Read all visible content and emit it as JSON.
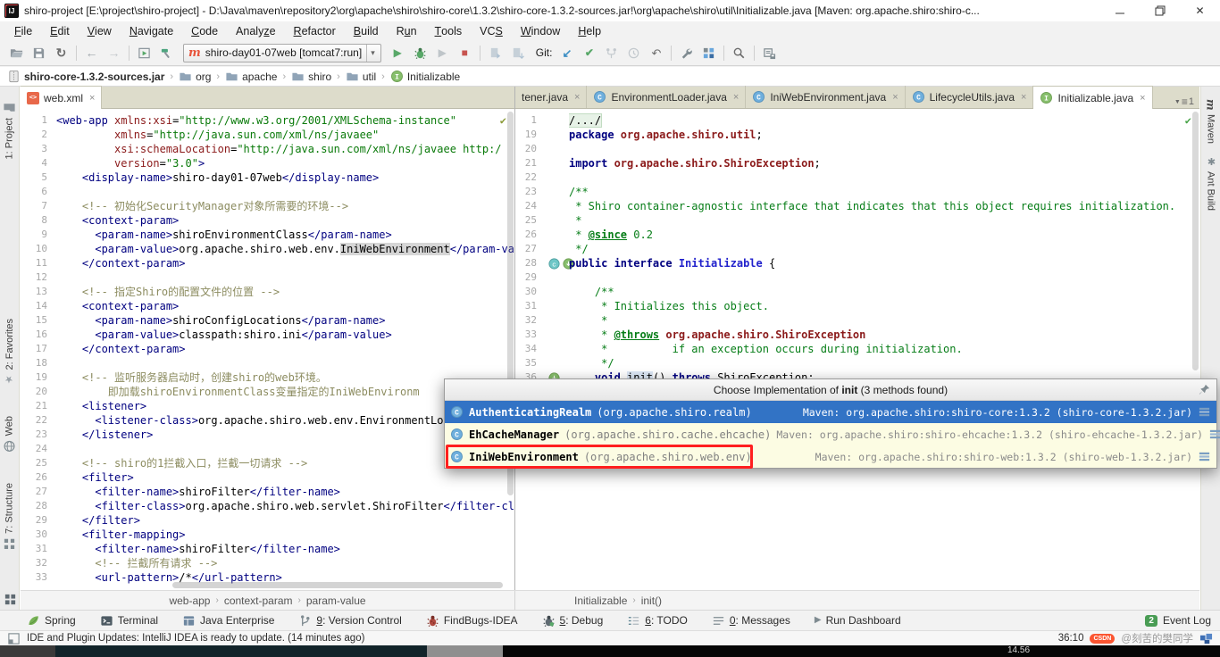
{
  "window": {
    "title": "shiro-project [E:\\project\\shiro-project] - D:\\Java\\maven\\repository2\\org\\apache\\shiro\\shiro-core\\1.3.2\\shiro-core-1.3.2-sources.jar!\\org\\apache\\shiro\\util\\Initializable.java [Maven: org.apache.shiro:shiro-c...",
    "controls": [
      "minimize-icon",
      "restore-icon",
      "close-icon"
    ]
  },
  "menu": {
    "items": [
      {
        "t": "File",
        "u": 0
      },
      {
        "t": "Edit",
        "u": 0
      },
      {
        "t": "View",
        "u": 0
      },
      {
        "t": "Navigate",
        "u": 0
      },
      {
        "t": "Code",
        "u": 0
      },
      {
        "t": "Analyze",
        "u": 5
      },
      {
        "t": "Refactor",
        "u": 0
      },
      {
        "t": "Build",
        "u": 0
      },
      {
        "t": "Run",
        "u": 1
      },
      {
        "t": "Tools",
        "u": 0
      },
      {
        "t": "VCS",
        "u": 2
      },
      {
        "t": "Window",
        "u": 0
      },
      {
        "t": "Help",
        "u": 0
      }
    ]
  },
  "toolbar": {
    "groups_before_combo": [
      [
        "open-icon",
        "save-all-icon",
        "sync-icon"
      ],
      [
        "back-icon",
        "forward-icon"
      ],
      [
        "run-window-icon",
        "build-hammer-icon"
      ]
    ],
    "run_config": {
      "icon": "maven-icon",
      "label": "shiro-day01-07web [tomcat7:run]",
      "chevron": "▾"
    },
    "run_group": [
      "run-icon",
      "debug-icon",
      "coverage-icon",
      "stop-icon"
    ],
    "update_group": [
      "update-app-icon",
      "update-resources-icon"
    ],
    "git_label": "Git:",
    "git_group": [
      "update-project-icon",
      "commit-icon",
      "merge-icon",
      "history-icon",
      "rollback-icon"
    ],
    "tail_groups": [
      [
        "settings-wrench-icon",
        "project-structure-icon"
      ],
      [
        "search-icon"
      ],
      [
        "sync-settings-icon"
      ]
    ]
  },
  "navbar": {
    "items": [
      {
        "label": "shiro-core-1.3.2-sources.jar",
        "icon": "jar-icon",
        "bold": true
      },
      {
        "label": "org",
        "icon": "folder-icon"
      },
      {
        "label": "apache",
        "icon": "folder-icon"
      },
      {
        "label": "shiro",
        "icon": "folder-icon"
      },
      {
        "label": "util",
        "icon": "folder-icon"
      },
      {
        "label": "Initializable",
        "icon": "interface-icon"
      }
    ]
  },
  "left_stripe": {
    "top": [
      {
        "label": "1: Project",
        "icon": "project-icon"
      }
    ],
    "bottom": [
      {
        "label": "2: Favorites",
        "icon": "star-icon"
      },
      {
        "label": "Web",
        "icon": "web-icon"
      },
      {
        "label": "7: Structure",
        "icon": "structure-icon"
      }
    ]
  },
  "right_stripe": {
    "items": [
      {
        "label": "Maven",
        "icon": "maven-side-icon"
      },
      {
        "label": "Ant Build",
        "icon": "ant-icon"
      }
    ]
  },
  "left_editor": {
    "tab": {
      "label": "web.xml",
      "icon": "xml-file-icon"
    },
    "crumbs": [
      "web-app",
      "context-param",
      "param-value"
    ],
    "lines": [
      {
        "n": "1",
        "s": [
          [
            "tag",
            "<web-app "
          ],
          [
            "attr",
            "xmlns:xsi"
          ],
          [
            "plain",
            "="
          ],
          [
            "val",
            "\"http://www.w3.org/2001/XMLSchema-instance\""
          ]
        ]
      },
      {
        "n": "2",
        "s": [
          [
            "plain",
            "         "
          ],
          [
            "attr",
            "xmlns"
          ],
          [
            "plain",
            "="
          ],
          [
            "val",
            "\"http://java.sun.com/xml/ns/javaee\""
          ]
        ]
      },
      {
        "n": "3",
        "s": [
          [
            "plain",
            "         "
          ],
          [
            "attr",
            "xsi:schemaLocation"
          ],
          [
            "plain",
            "="
          ],
          [
            "val",
            "\"http://java.sun.com/xml/ns/javaee http:/"
          ]
        ]
      },
      {
        "n": "4",
        "s": [
          [
            "plain",
            "         "
          ],
          [
            "attr",
            "version"
          ],
          [
            "plain",
            "="
          ],
          [
            "val",
            "\"3.0\""
          ],
          [
            "tag",
            ">"
          ]
        ]
      },
      {
        "n": "5",
        "s": [
          [
            "plain",
            "    "
          ],
          [
            "tag",
            "<display-name>"
          ],
          [
            "txt",
            "shiro-day01-07web"
          ],
          [
            "tag",
            "</display-name>"
          ]
        ]
      },
      {
        "n": "6",
        "s": []
      },
      {
        "n": "7",
        "s": [
          [
            "plain",
            "    "
          ],
          [
            "com",
            "<!-- 初始化SecurityManager对象所需要的环境-->"
          ]
        ]
      },
      {
        "n": "8",
        "s": [
          [
            "plain",
            "    "
          ],
          [
            "tag",
            "<context-param>"
          ]
        ]
      },
      {
        "n": "9",
        "s": [
          [
            "plain",
            "      "
          ],
          [
            "tag",
            "<param-name>"
          ],
          [
            "txt",
            "shiroEnvironmentClass"
          ],
          [
            "tag",
            "</param-name>"
          ]
        ]
      },
      {
        "n": "10",
        "s": [
          [
            "plain",
            "      "
          ],
          [
            "tag",
            "<param-value>"
          ],
          [
            "txt",
            "org.apache.shiro.web.env."
          ],
          [
            "hl",
            "IniWebEnvironment"
          ],
          [
            "tag",
            "</param-va"
          ]
        ]
      },
      {
        "n": "11",
        "s": [
          [
            "plain",
            "    "
          ],
          [
            "tag",
            "</context-param>"
          ]
        ]
      },
      {
        "n": "12",
        "s": []
      },
      {
        "n": "13",
        "s": [
          [
            "plain",
            "    "
          ],
          [
            "com",
            "<!-- 指定Shiro的配置文件的位置 -->"
          ]
        ]
      },
      {
        "n": "14",
        "s": [
          [
            "plain",
            "    "
          ],
          [
            "tag",
            "<context-param>"
          ]
        ]
      },
      {
        "n": "15",
        "s": [
          [
            "plain",
            "      "
          ],
          [
            "tag",
            "<param-name>"
          ],
          [
            "txt",
            "shiroConfigLocations"
          ],
          [
            "tag",
            "</param-name>"
          ]
        ]
      },
      {
        "n": "16",
        "s": [
          [
            "plain",
            "      "
          ],
          [
            "tag",
            "<param-value>"
          ],
          [
            "txt",
            "classpath:shiro.ini"
          ],
          [
            "tag",
            "</param-value>"
          ]
        ]
      },
      {
        "n": "17",
        "s": [
          [
            "plain",
            "    "
          ],
          [
            "tag",
            "</context-param>"
          ]
        ]
      },
      {
        "n": "18",
        "s": []
      },
      {
        "n": "19",
        "s": [
          [
            "plain",
            "    "
          ],
          [
            "com",
            "<!-- 监听服务器启动时，创建shiro的web环境。"
          ]
        ]
      },
      {
        "n": "20",
        "s": [
          [
            "plain",
            "        "
          ],
          [
            "com",
            "即加载shiroEnvironmentClass变量指定的IniWebEnvironm"
          ]
        ]
      },
      {
        "n": "21",
        "s": [
          [
            "plain",
            "    "
          ],
          [
            "tag",
            "<listener>"
          ]
        ]
      },
      {
        "n": "22",
        "s": [
          [
            "plain",
            "      "
          ],
          [
            "tag",
            "<listener-class>"
          ],
          [
            "txt",
            "org.apache.shiro.web.env.EnvironmentLo"
          ]
        ]
      },
      {
        "n": "23",
        "s": [
          [
            "plain",
            "    "
          ],
          [
            "tag",
            "</listener>"
          ]
        ]
      },
      {
        "n": "24",
        "s": []
      },
      {
        "n": "25",
        "s": [
          [
            "plain",
            "    "
          ],
          [
            "com",
            "<!-- shiro的1拦截入口，拦截一切请求 -->"
          ]
        ]
      },
      {
        "n": "26",
        "s": [
          [
            "plain",
            "    "
          ],
          [
            "tag",
            "<filter>"
          ]
        ]
      },
      {
        "n": "27",
        "s": [
          [
            "plain",
            "      "
          ],
          [
            "tag",
            "<filter-name>"
          ],
          [
            "txt",
            "shiroFilter"
          ],
          [
            "tag",
            "</filter-name>"
          ]
        ]
      },
      {
        "n": "28",
        "s": [
          [
            "plain",
            "      "
          ],
          [
            "tag",
            "<filter-class>"
          ],
          [
            "txt",
            "org.apache.shiro.web.servlet.ShiroFilter"
          ],
          [
            "tag",
            "</filter-cl"
          ]
        ]
      },
      {
        "n": "29",
        "s": [
          [
            "plain",
            "    "
          ],
          [
            "tag",
            "</filter>"
          ]
        ]
      },
      {
        "n": "30",
        "s": [
          [
            "plain",
            "    "
          ],
          [
            "tag",
            "<filter-mapping>"
          ]
        ]
      },
      {
        "n": "31",
        "s": [
          [
            "plain",
            "      "
          ],
          [
            "tag",
            "<filter-name>"
          ],
          [
            "txt",
            "shiroFilter"
          ],
          [
            "tag",
            "</filter-name>"
          ]
        ]
      },
      {
        "n": "32",
        "s": [
          [
            "plain",
            "      "
          ],
          [
            "com",
            "<!-- 拦截所有请求 -->"
          ]
        ]
      },
      {
        "n": "33",
        "s": [
          [
            "plain",
            "      "
          ],
          [
            "tag",
            "<url-pattern>"
          ],
          [
            "txt",
            "/*"
          ],
          [
            "tag",
            "</url-pattern>"
          ]
        ]
      }
    ]
  },
  "right_editor": {
    "tabs": [
      {
        "label": "tener.java",
        "icon": null,
        "close": true
      },
      {
        "label": "EnvironmentLoader.java",
        "icon": "class-icon",
        "close": true
      },
      {
        "label": "IniWebEnvironment.java",
        "icon": "class-icon",
        "close": true
      },
      {
        "label": "LifecycleUtils.java",
        "icon": "class-icon",
        "close": true
      },
      {
        "label": "Initializable.java",
        "icon": "interface-icon",
        "close": true,
        "active": true
      }
    ],
    "tabs_overflow": "1",
    "crumbs": [
      "Initializable",
      "init()"
    ],
    "lines": [
      {
        "n": "1",
        "s": [
          [
            "fold",
            "/.../"
          ]
        ]
      },
      {
        "n": "19",
        "s": [
          [
            "kw",
            "package "
          ],
          [
            "pkgref",
            "org.apache.shiro.util"
          ],
          [
            "plain",
            ";"
          ]
        ]
      },
      {
        "n": "20",
        "s": []
      },
      {
        "n": "21",
        "s": [
          [
            "kw",
            "import "
          ],
          [
            "pkgref",
            "org.apache.shiro.ShiroException"
          ],
          [
            "plain",
            ";"
          ]
        ]
      },
      {
        "n": "22",
        "s": []
      },
      {
        "n": "23",
        "s": [
          [
            "doc",
            "/**"
          ]
        ]
      },
      {
        "n": "24",
        "s": [
          [
            "doc",
            " * Shiro container-agnostic interface that indicates that this object requires initialization."
          ]
        ]
      },
      {
        "n": "25",
        "s": [
          [
            "doc",
            " *"
          ]
        ]
      },
      {
        "n": "26",
        "s": [
          [
            "doc",
            " * "
          ],
          [
            "doctag",
            "@since"
          ],
          [
            "doc",
            " 0.2"
          ]
        ]
      },
      {
        "n": "27",
        "s": [
          [
            "doc",
            " */"
          ]
        ]
      },
      {
        "n": "28",
        "g": "impl-pair",
        "s": [
          [
            "kw",
            "public interface "
          ],
          [
            "iface",
            "Initializable"
          ],
          [
            "plain",
            " {"
          ]
        ]
      },
      {
        "n": "29",
        "s": []
      },
      {
        "n": "30",
        "s": [
          [
            "doc",
            "    /**"
          ]
        ]
      },
      {
        "n": "31",
        "s": [
          [
            "doc",
            "     * Initializes this object."
          ]
        ]
      },
      {
        "n": "32",
        "s": [
          [
            "doc",
            "     *"
          ]
        ]
      },
      {
        "n": "33",
        "s": [
          [
            "doc",
            "     * "
          ],
          [
            "doctag",
            "@throws"
          ],
          [
            "doc",
            " "
          ],
          [
            "pkgref",
            "org.apache.shiro.ShiroException"
          ]
        ]
      },
      {
        "n": "34",
        "s": [
          [
            "doc",
            "     *          if an exception occurs during initialization."
          ]
        ]
      },
      {
        "n": "35",
        "s": [
          [
            "doc",
            "     */"
          ]
        ]
      },
      {
        "n": "36",
        "g": "impl-single",
        "s": [
          [
            "plain",
            "    "
          ],
          [
            "kw",
            "void "
          ],
          [
            "hl2",
            "init"
          ],
          [
            "plain",
            "() "
          ],
          [
            "kw",
            "throws "
          ],
          [
            "plain",
            "ShiroException;"
          ]
        ]
      }
    ]
  },
  "popup": {
    "title": {
      "prefix": "Choose Implementation of ",
      "emph": "init",
      "suffix": " (3 methods found)"
    },
    "rows": [
      {
        "name": "AuthenticatingRealm",
        "pkg": "(org.apache.shiro.realm)",
        "lib": "Maven: org.apache.shiro:shiro-core:1.3.2 (shiro-core-1.3.2.jar)",
        "icon": "class-icon",
        "lib_icon": "library-icon",
        "selected": true
      },
      {
        "name": "EhCacheManager",
        "pkg": "(org.apache.shiro.cache.ehcache)",
        "lib": "Maven: org.apache.shiro:shiro-ehcache:1.3.2 (shiro-ehcache-1.3.2.jar)",
        "icon": "class-icon",
        "lib_icon": "library-icon"
      },
      {
        "name": "IniWebEnvironment",
        "pkg": "(org.apache.shiro.web.env)",
        "lib": "Maven: org.apache.shiro:shiro-web:1.3.2 (shiro-web-1.3.2.jar)",
        "icon": "class-icon",
        "lib_icon": "library-icon",
        "annotated": true
      }
    ]
  },
  "bottom_bar": {
    "left": [
      {
        "label": "Spring",
        "icon": "spring-icon"
      },
      {
        "label": "Terminal",
        "icon": "terminal-icon"
      },
      {
        "label": "Java Enterprise",
        "icon": "javaee-icon"
      },
      {
        "num": "9",
        "label": ": Version Control",
        "icon": "vcs-icon"
      },
      {
        "label": "FindBugs-IDEA",
        "icon": "findbugs-icon"
      },
      {
        "num": "5",
        "label": ": Debug",
        "icon": "debug-tool-icon"
      },
      {
        "num": "6",
        "label": ": TODO",
        "icon": "todo-icon"
      },
      {
        "num": "0",
        "label": ": Messages",
        "icon": "messages-icon"
      },
      {
        "label": "Run Dashboard",
        "icon": "run-dashboard-icon"
      }
    ],
    "right": {
      "badge": "2",
      "label": "Event Log"
    }
  },
  "status_bar": {
    "message": "IDE and Plugin Updates: IntelliJ IDEA is ready to update. (14 minutes ago)",
    "time": "36:10",
    "watermark": {
      "logo": "CSDN",
      "text": "@刻苦的樊同学"
    }
  },
  "bottom_strip": {
    "time": "14.56"
  },
  "colors": {
    "selection_blue": "#3273C5",
    "popup_cream": "#FCFCE3",
    "annotation_red": "#FF1F1F",
    "run_green": "#59A869",
    "stop_red": "#C75450"
  }
}
